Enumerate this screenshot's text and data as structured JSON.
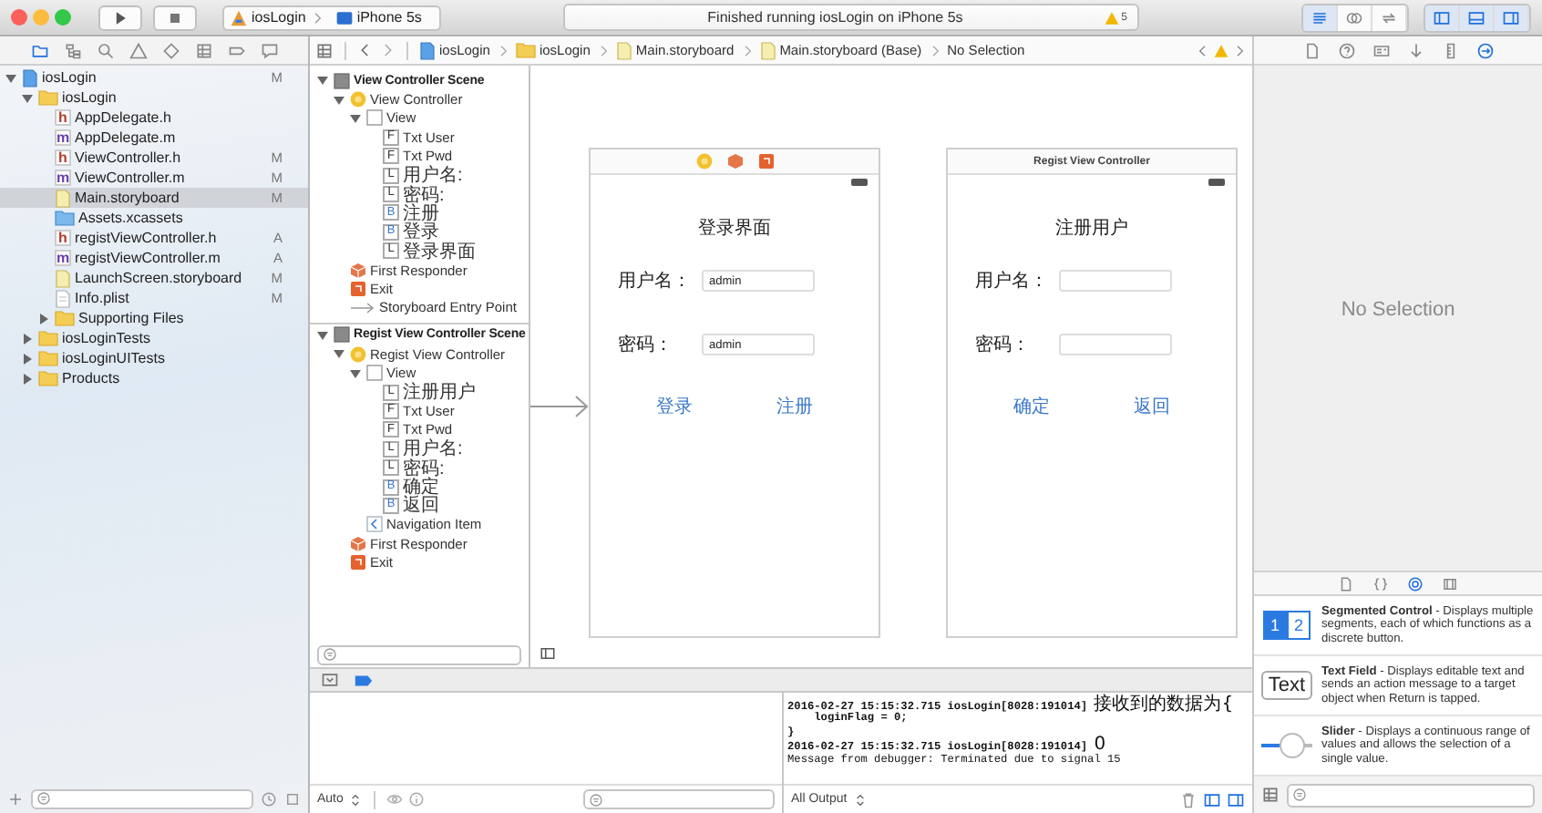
{
  "toolbar": {
    "scheme": "iosLogin",
    "device": "iPhone 5s",
    "status": "Finished running iosLogin on iPhone 5s",
    "warnings": "5",
    "editor_modes": [
      {
        "kind": "standard",
        "selected": true
      },
      {
        "kind": "assistant",
        "selected": false
      },
      {
        "kind": "version",
        "selected": false
      }
    ],
    "panels": [
      {
        "kind": "left",
        "on": true
      },
      {
        "kind": "bottom",
        "on": true
      },
      {
        "kind": "right",
        "on": true
      }
    ]
  },
  "navigator": {
    "tabs": [
      {
        "kind": "folder",
        "selected": true
      },
      {
        "kind": "symbol",
        "selected": false
      },
      {
        "kind": "search",
        "selected": false
      },
      {
        "kind": "issue",
        "selected": false
      },
      {
        "kind": "test",
        "selected": false
      },
      {
        "kind": "debug",
        "selected": false
      },
      {
        "kind": "breakpoint",
        "selected": false
      },
      {
        "kind": "report",
        "selected": false
      }
    ],
    "items": [
      {
        "name": "iosLogin",
        "kind": "project",
        "status": "M",
        "expanded": true,
        "selected": false,
        "children": [
          {
            "name": "iosLogin",
            "kind": "folder",
            "expanded": true,
            "selected": false,
            "children": [
              {
                "name": "AppDelegate.h",
                "kind": "header",
                "badge": "h",
                "selected": false
              },
              {
                "name": "AppDelegate.m",
                "kind": "source",
                "badge": "m",
                "selected": false
              },
              {
                "name": "ViewController.h",
                "kind": "header",
                "badge": "h",
                "status": "M",
                "selected": false
              },
              {
                "name": "ViewController.m",
                "kind": "source",
                "badge": "m",
                "status": "M",
                "selected": false
              },
              {
                "name": "Main.storyboard",
                "kind": "storyboard",
                "status": "M",
                "selected": true
              },
              {
                "name": "Assets.xcassets",
                "kind": "assets",
                "selected": false
              },
              {
                "name": "registViewController.h",
                "kind": "header",
                "badge": "h",
                "status": "A",
                "selected": false
              },
              {
                "name": "registViewController.m",
                "kind": "source",
                "badge": "m",
                "status": "A",
                "selected": false
              },
              {
                "name": "LaunchScreen.storyboard",
                "kind": "storyboard",
                "status": "M",
                "selected": false
              },
              {
                "name": "Info.plist",
                "kind": "plist",
                "status": "M",
                "selected": false
              },
              {
                "name": "Supporting Files",
                "kind": "folder",
                "expanded": false,
                "selected": false
              }
            ]
          },
          {
            "name": "iosLoginTests",
            "kind": "folder",
            "expanded": false,
            "selected": false
          },
          {
            "name": "iosLoginUITests",
            "kind": "folder",
            "expanded": false,
            "selected": false
          },
          {
            "name": "Products",
            "kind": "folder",
            "expanded": false,
            "selected": false
          }
        ]
      }
    ]
  },
  "jump_bar": {
    "crumbs": [
      {
        "kind": "project",
        "text": "iosLogin"
      },
      {
        "kind": "folder",
        "text": "iosLogin"
      },
      {
        "kind": "storyboard",
        "text": "Main.storyboard"
      },
      {
        "kind": "storyboard",
        "text": "Main.storyboard (Base)"
      },
      {
        "kind": "none",
        "text": "No Selection"
      }
    ]
  },
  "outline": {
    "items": [
      {
        "name": "View Controller Scene",
        "kind": "scene",
        "expanded": true,
        "children": [
          {
            "name": "View Controller",
            "kind": "controller",
            "expanded": true,
            "children": [
              {
                "name": "View",
                "kind": "view",
                "expanded": true,
                "children": [
                  {
                    "name": "Txt User",
                    "kind": "field",
                    "badge": "F"
                  },
                  {
                    "name": "Txt Pwd",
                    "kind": "field",
                    "badge": "F"
                  },
                  {
                    "name": "用户名:",
                    "kind": "label",
                    "badge": "L"
                  },
                  {
                    "name": "密码:",
                    "kind": "label",
                    "badge": "L"
                  },
                  {
                    "name": "注册",
                    "kind": "button",
                    "badge": "B"
                  },
                  {
                    "name": "登录",
                    "kind": "button",
                    "badge": "B"
                  },
                  {
                    "name": "登录界面",
                    "kind": "label",
                    "badge": "L"
                  }
                ]
              }
            ]
          },
          {
            "name": "First Responder",
            "kind": "responder"
          },
          {
            "name": "Exit",
            "kind": "exit"
          },
          {
            "name": "Storyboard Entry Point",
            "kind": "entry"
          }
        ]
      },
      {
        "name": "Regist View Controller Scene",
        "kind": "scene",
        "expanded": true,
        "children": [
          {
            "name": "Regist View Controller",
            "kind": "controller",
            "expanded": true,
            "children": [
              {
                "name": "View",
                "kind": "view",
                "expanded": true,
                "children": [
                  {
                    "name": "注册用户",
                    "kind": "label",
                    "badge": "L"
                  },
                  {
                    "name": "Txt User",
                    "kind": "field",
                    "badge": "F"
                  },
                  {
                    "name": "Txt Pwd",
                    "kind": "field",
                    "badge": "F"
                  },
                  {
                    "name": "用户名:",
                    "kind": "label",
                    "badge": "L"
                  },
                  {
                    "name": "密码:",
                    "kind": "label",
                    "badge": "L"
                  },
                  {
                    "name": "确定",
                    "kind": "button",
                    "badge": "B"
                  },
                  {
                    "name": "返回",
                    "kind": "button",
                    "badge": "B"
                  }
                ]
              },
              {
                "name": "Navigation Item",
                "kind": "navigation"
              }
            ]
          },
          {
            "name": "First Responder",
            "kind": "responder"
          },
          {
            "name": "Exit",
            "kind": "exit"
          }
        ]
      }
    ]
  },
  "canvas": {
    "scenes": [
      {
        "kind": "icons",
        "heading": "登录界面",
        "fields": [
          {
            "label": "用户名：",
            "value": "admin"
          },
          {
            "label": "密码：",
            "value": "admin"
          }
        ],
        "buttons": [
          "登录",
          "注册"
        ],
        "entry_point": true
      },
      {
        "kind": "title",
        "title": "Regist View Controller",
        "heading": "注册用户",
        "fields": [
          {
            "label": "用户名："
          },
          {
            "label": "密码："
          }
        ],
        "buttons": [
          "确定",
          "返回"
        ],
        "entry_point": false
      }
    ]
  },
  "debug": {
    "scope": "Auto",
    "output": "All Output",
    "console": [
      {
        "kind": "log",
        "text": "2016-02-27 15:15:32.715 iosLogin[8028:191014]",
        "message": "接收到的数据为{"
      },
      {
        "kind": "log",
        "text": "    loginFlag = 0;"
      },
      {
        "kind": "log",
        "text": "}"
      },
      {
        "kind": "log",
        "text": "2016-02-27 15:15:32.715 iosLogin[8028:191014]",
        "message": "0"
      },
      {
        "kind": "debugger",
        "text": "Message from debugger: Terminated due to signal 15"
      }
    ]
  },
  "inspector": {
    "tabs": [
      {
        "kind": "file",
        "selected": false
      },
      {
        "kind": "help",
        "selected": false
      },
      {
        "kind": "identity",
        "selected": false
      },
      {
        "kind": "attributes",
        "selected": false
      },
      {
        "kind": "size",
        "selected": false
      },
      {
        "kind": "connections",
        "selected": true
      }
    ],
    "message": "No Selection",
    "library_tabs": [
      {
        "kind": "file",
        "selected": false
      },
      {
        "kind": "code",
        "selected": false
      },
      {
        "kind": "object",
        "selected": true
      },
      {
        "kind": "media",
        "selected": false
      }
    ],
    "library": [
      {
        "kind": "segmented",
        "segments": [
          {
            "label": "1",
            "selected": true
          },
          {
            "label": "2",
            "selected": false
          }
        ],
        "description": "**Segmented Control** - Displays multiple segments, each of which functions as a discrete button."
      },
      {
        "kind": "textfield",
        "sample": "Text",
        "description": "**Text Field** - Displays editable text and sends an action message to a target object when Return is tapped."
      },
      {
        "kind": "slider",
        "level": 0.35,
        "description": "**Slider** - Displays a continuous range of values and allows the selection of a single value."
      }
    ]
  }
}
